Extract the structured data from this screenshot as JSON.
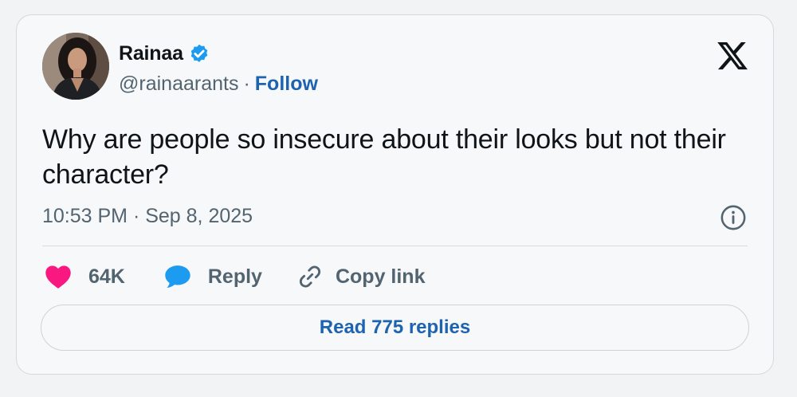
{
  "author": {
    "name": "Rainaa",
    "handle": "@rainaarants",
    "separator": "·",
    "follow_label": "Follow",
    "verified_icon": "verified-badge-icon",
    "avatar": "profile-photo"
  },
  "tweet": {
    "text": "Why are people so insecure about their looks but not their character?",
    "timestamp": "10:53 PM · Sep 8, 2025"
  },
  "actions": {
    "like_count": "64K",
    "reply_label": "Reply",
    "copy_link_label": "Copy link"
  },
  "footer": {
    "read_replies_label": "Read 775 replies"
  },
  "icons": {
    "brand": "x-logo-icon",
    "info": "info-icon",
    "like": "heart-icon",
    "reply": "speech-bubble-icon",
    "copy": "link-icon"
  },
  "colors": {
    "accent": "#1d63b0",
    "verified": "#1d9bf0",
    "like": "#f91880",
    "reply": "#1d9bf0",
    "muted_text": "#536471",
    "text": "#0f1419",
    "card_background": "#f7f8f9",
    "border": "#d6d9dc"
  }
}
